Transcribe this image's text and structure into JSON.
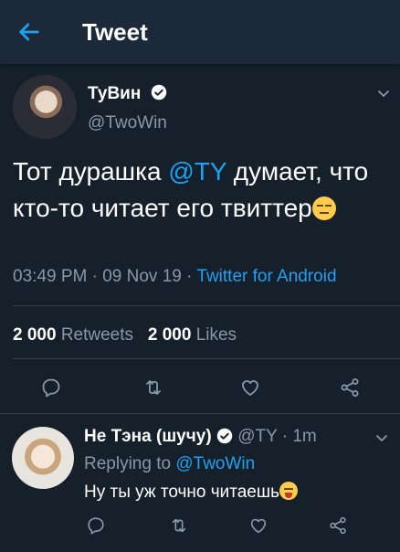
{
  "header": {
    "title": "Tweet"
  },
  "tweet": {
    "display_name": "ТуВин",
    "handle": "@TwoWin",
    "text_before": "Тот дурашка ",
    "mention": "@TY",
    "text_after": " думает, что кто-то читает его твиттер",
    "time": "03:49 PM",
    "sep1": "·",
    "date": "09 Nov 19",
    "sep2": "·",
    "source": "Twitter for Android",
    "retweets_count": "2 000",
    "retweets_label": "Retweets",
    "likes_count": "2 000",
    "likes_label": "Likes"
  },
  "reply": {
    "display_name": "Не Тэна (шучу)",
    "handle": "@TY",
    "sep": "·",
    "time": "1m",
    "replying_to_label": "Replying to",
    "replying_to_handle": "@TwoWin",
    "text": "Ну ты уж точно читаешь"
  },
  "colors": {
    "background": "#15202b",
    "header": "#1c2938",
    "accent": "#1da1f2",
    "muted": "#8899a6",
    "divider": "#38444d"
  },
  "icons": [
    "back-arrow-icon",
    "verified-icon",
    "chevron-down-icon",
    "reply-icon",
    "retweet-icon",
    "like-icon",
    "share-icon"
  ]
}
